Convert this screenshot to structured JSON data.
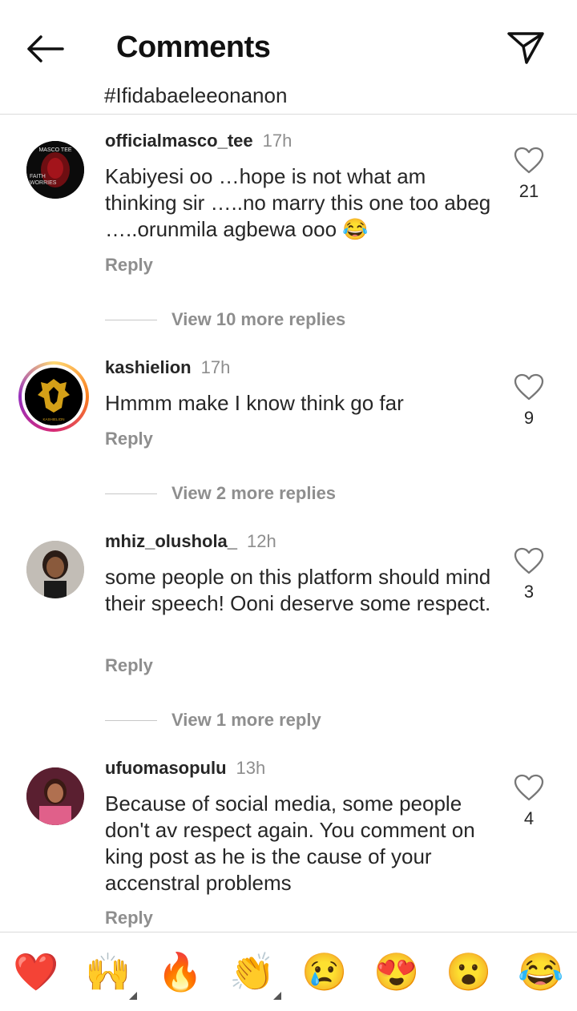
{
  "header": {
    "title": "Comments"
  },
  "cutoff_text": "#Ifidabaeleeonanon",
  "comments": [
    {
      "username": "officialmasco_tee",
      "time": "17h",
      "text": "Kabiyesi oo …hope is not what am thinking sir …..no marry this one too abeg …..orunmila agbewa ooo 😂",
      "reply": "Reply",
      "likes": "21",
      "view_more": "View 10 more replies",
      "avatar_text": "MASCO TEE",
      "avatar_text2": "FAITH",
      "avatar_text3": "WORRIES"
    },
    {
      "username": "kashielion",
      "time": "17h",
      "text": "Hmmm make I know think go far",
      "reply": "Reply",
      "likes": "9",
      "view_more": "View 2 more replies",
      "avatar_text": "KASHIELION"
    },
    {
      "username": "mhiz_olushola_",
      "time": "12h",
      "text": "some people on this platform should mind their speech! Ooni deserve  some respect.",
      "reply": "Reply",
      "likes": "3",
      "view_more": "View 1 more reply"
    },
    {
      "username": "ufuomasopulu",
      "time": "13h",
      "text": "Because of social media, some people don't av respect again. You comment on king post as he is the cause of your accenstral problems",
      "reply": "Reply",
      "likes": "4"
    }
  ],
  "emoji_bar": {
    "emojis": [
      "❤️",
      "🙌",
      "🔥",
      "👏",
      "😢",
      "😍",
      "😮",
      "😂"
    ],
    "names": [
      "red-heart",
      "raising-hands",
      "fire",
      "clapping-hands",
      "crying-face",
      "heart-eyes",
      "astonished-face",
      "tears-of-joy"
    ]
  },
  "colors": {
    "username": "#262626",
    "meta": "#8e8e8e",
    "divider": "#dbdbdb",
    "heart": "#e0245e"
  }
}
